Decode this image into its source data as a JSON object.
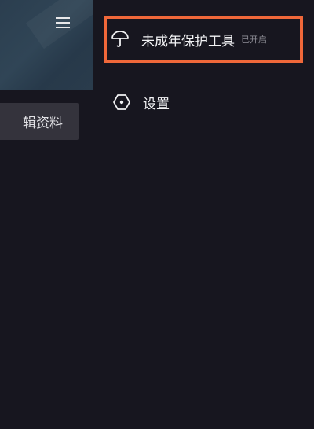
{
  "profile": {
    "menu_icon": "hamburger-menu-icon",
    "edit_profile_label": "辑资料"
  },
  "drawer": {
    "items": [
      {
        "label": "未成年保护工具",
        "status": "已开启",
        "icon": "umbrella-icon"
      },
      {
        "label": "设置",
        "icon": "hexagon-settings-icon"
      }
    ]
  },
  "colors": {
    "background": "#17161f",
    "highlight": "#f0683a",
    "button_bg": "#34333c"
  }
}
